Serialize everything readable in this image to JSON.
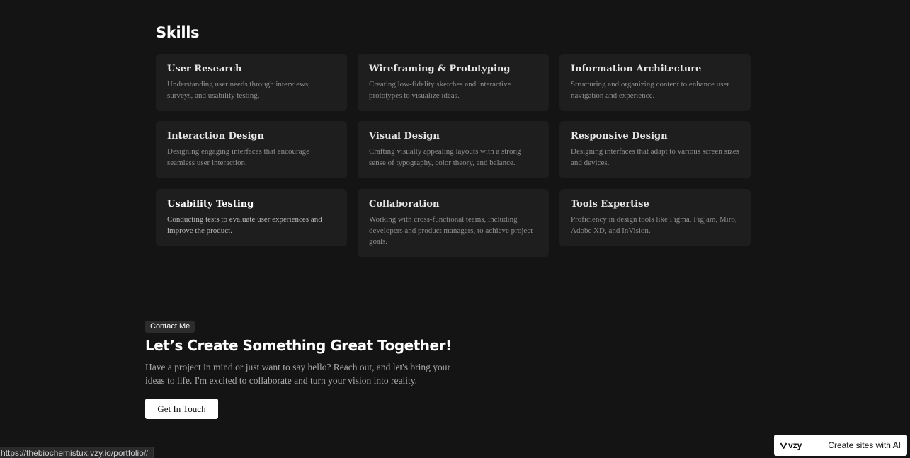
{
  "skills": {
    "title": "Skills",
    "items": [
      {
        "name": "User Research",
        "description": "Understanding user needs through interviews, surveys, and usability testing."
      },
      {
        "name": "Wireframing & Prototyping",
        "description": "Creating low-fidelity sketches and interactive prototypes to visualize ideas."
      },
      {
        "name": "Information Architecture",
        "description": "Structuring and organizing content to enhance user navigation and experience."
      },
      {
        "name": "Interaction Design",
        "description": "Designing engaging interfaces that encourage seamless user interaction."
      },
      {
        "name": "Visual Design",
        "description": "Crafting visually appealing layouts with a strong sense of typography, color theory, and balance."
      },
      {
        "name": "Responsive Design",
        "description": "Designing interfaces that adapt to various screen sizes and devices."
      },
      {
        "name": "Usability Testing",
        "description": "Conducting tests to evaluate user experiences and improve the product."
      },
      {
        "name": "Collaboration",
        "description": "Working with cross-functional teams, including developers and product managers, to achieve project goals."
      },
      {
        "name": "Tools Expertise",
        "description": "Proficiency in design tools like Figma, Figjam, Miro, Adobe XD, and InVision."
      }
    ]
  },
  "contact": {
    "badge": "Contact Me",
    "title": "Let’s Create Something Great Together!",
    "description": "Have a project in mind or just want to say hello? Reach out, and let's bring your ideas to life. I'm excited to collaborate and turn your vision into reality.",
    "button_label": "Get In Touch"
  },
  "status_bar": {
    "url": "https://thebiochemistux.vzy.io/portfolio#"
  },
  "vzy_badge": {
    "logo_text": "vzy",
    "logo_icon": "vzy-logo-icon",
    "cta": "Create sites with AI"
  },
  "colors": {
    "background": "#141414",
    "card": "#1e1e1e",
    "button": "#ffffff"
  }
}
